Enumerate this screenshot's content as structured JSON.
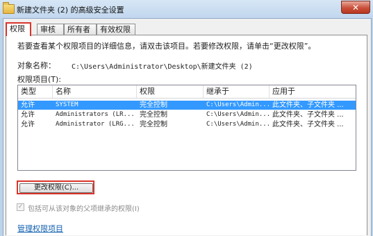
{
  "window": {
    "title": "新建文件夹 (2) 的高级安全设置",
    "close_symbol": "✕"
  },
  "tabs": [
    {
      "label": "权限",
      "active": true
    },
    {
      "label": "审核",
      "active": false
    },
    {
      "label": "所有者",
      "active": false
    },
    {
      "label": "有效权限",
      "active": false
    }
  ],
  "permissions_page": {
    "instruction": "若要查看某个权限项目的详细信息，请双击该项目。若要修改权限，请单击“更改权限”。",
    "object_label": "对象名称：",
    "object_value": "C:\\Users\\Administrator\\Desktop\\新建文件夹 (2)",
    "entries_label": "权限项目(T):",
    "columns": [
      "类型",
      "名称",
      "权限",
      "继承于",
      "应用于"
    ],
    "rows": [
      {
        "type": "允许",
        "name": "SYSTEM",
        "permission": "完全控制",
        "inherited_from": "C:\\Users\\Admin...",
        "applies_to": "此文件夹、子文件夹 ...",
        "selected": true
      },
      {
        "type": "允许",
        "name": "Administrators (LR...",
        "permission": "完全控制",
        "inherited_from": "C:\\Users\\Admin...",
        "applies_to": "此文件夹、子文件夹 ...",
        "selected": false
      },
      {
        "type": "允许",
        "name": "Administrator (LRG...",
        "permission": "完全控制",
        "inherited_from": "C:\\Users\\Admin...",
        "applies_to": "此文件夹、子文件夹 ...",
        "selected": false
      }
    ],
    "change_button": "更改权限(C)...",
    "inherit_checkbox_label": "包括可从该对象的父项继承的权限(I)",
    "inherit_checked": true,
    "manage_link": "管理权限项目"
  },
  "colors": {
    "accent_red": "#d9342b",
    "selection_blue": "#3399ff",
    "link_blue": "#1160b0"
  }
}
